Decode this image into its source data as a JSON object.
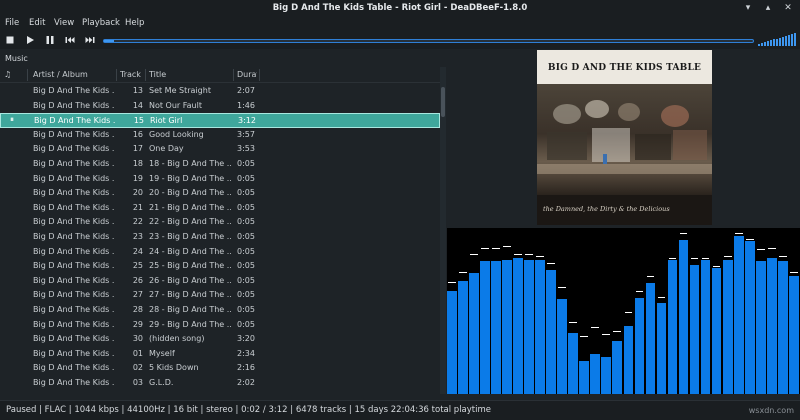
{
  "window": {
    "title": "Big D And The Kids Table - Riot Girl - DeaDBeeF-1.8.0"
  },
  "menu": [
    "File",
    "Edit",
    "View",
    "Playback",
    "Help"
  ],
  "tabs": [
    "Music"
  ],
  "columns": {
    "playing": "♫",
    "artist": "Artist / Album",
    "track": "Track No",
    "title": "Title",
    "duration": "Duration"
  },
  "rows": [
    {
      "artist": "Big D And The Kids ...",
      "track": "13",
      "title": "Set Me Straight",
      "duration": "2:07"
    },
    {
      "artist": "Big D And The Kids ...",
      "track": "14",
      "title": "Not Our Fault",
      "duration": "1:46"
    },
    {
      "artist": "Big D And The Kids ...",
      "track": "15",
      "title": "Riot Girl",
      "duration": "3:12",
      "selected": true
    },
    {
      "artist": "Big D And The Kids ...",
      "track": "16",
      "title": "Good Looking",
      "duration": "3:57"
    },
    {
      "artist": "Big D And The Kids ...",
      "track": "17",
      "title": "One Day",
      "duration": "3:53"
    },
    {
      "artist": "Big D And The Kids ...",
      "track": "18",
      "title": "18 - Big D And The ...",
      "duration": "0:05"
    },
    {
      "artist": "Big D And The Kids ...",
      "track": "19",
      "title": "19 - Big D And The ...",
      "duration": "0:05"
    },
    {
      "artist": "Big D And The Kids ...",
      "track": "20",
      "title": "20 - Big D And The ...",
      "duration": "0:05"
    },
    {
      "artist": "Big D And The Kids ...",
      "track": "21",
      "title": "21 - Big D And The ...",
      "duration": "0:05"
    },
    {
      "artist": "Big D And The Kids ...",
      "track": "22",
      "title": "22 - Big D And The ...",
      "duration": "0:05"
    },
    {
      "artist": "Big D And The Kids ...",
      "track": "23",
      "title": "23 - Big D And The ...",
      "duration": "0:05"
    },
    {
      "artist": "Big D And The Kids ...",
      "track": "24",
      "title": "24 - Big D And The ...",
      "duration": "0:05"
    },
    {
      "artist": "Big D And The Kids ...",
      "track": "25",
      "title": "25 - Big D And The ...",
      "duration": "0:05"
    },
    {
      "artist": "Big D And The Kids ...",
      "track": "26",
      "title": "26 - Big D And The ...",
      "duration": "0:05"
    },
    {
      "artist": "Big D And The Kids ...",
      "track": "27",
      "title": "27 - Big D And The ...",
      "duration": "0:05"
    },
    {
      "artist": "Big D And The Kids ...",
      "track": "28",
      "title": "28 - Big D And The ...",
      "duration": "0:05"
    },
    {
      "artist": "Big D And The Kids ...",
      "track": "29",
      "title": "29 - Big D And The ...",
      "duration": "0:05"
    },
    {
      "artist": "Big D And The Kids ...",
      "track": "30",
      "title": "(hidden song)",
      "duration": "3:20"
    },
    {
      "artist": "Big D And The Kids ...",
      "track": "01",
      "title": "Myself",
      "duration": "2:34"
    },
    {
      "artist": "Big D And The Kids ...",
      "track": "02",
      "title": "5 Kids Down",
      "duration": "2:16"
    },
    {
      "artist": "Big D And The Kids ...",
      "track": "03",
      "title": "G.L.D.",
      "duration": "2:02"
    }
  ],
  "playback": {
    "progress": 0.0161
  },
  "volume": {
    "level": 1.0
  },
  "album_art": {
    "band_text": "BIG D AND THE KIDS TABLE",
    "album_text": "the Damned, the Dirty & the Delicious"
  },
  "visualizer": {
    "bars": [
      0.62,
      0.68,
      0.73,
      0.8,
      0.8,
      0.81,
      0.82,
      0.81,
      0.81,
      0.75,
      0.57,
      0.37,
      0.2,
      0.24,
      0.22,
      0.32,
      0.41,
      0.58,
      0.67,
      0.55,
      0.81,
      0.93,
      0.78,
      0.81,
      0.76,
      0.81,
      0.95,
      0.92,
      0.8,
      0.82,
      0.8,
      0.71
    ],
    "peaks": [
      0.66,
      0.72,
      0.83,
      0.87,
      0.87,
      0.88,
      0.83,
      0.83,
      0.82,
      0.78,
      0.63,
      0.42,
      0.34,
      0.39,
      0.35,
      0.37,
      0.48,
      0.61,
      0.7,
      0.57,
      0.81,
      0.96,
      0.81,
      0.81,
      0.76,
      0.82,
      0.96,
      0.92,
      0.86,
      0.87,
      0.82,
      0.72
    ]
  },
  "status": {
    "text": "Paused | FLAC | 1044 kbps | 44100Hz | 16 bit | stereo | 0:02 / 3:12 | 6478 tracks | 15 days 22:04:36 total playtime"
  },
  "watermark": "wsxdn.com",
  "colors": {
    "accent": "#3e97f0",
    "selection": "#3fa79c",
    "visualizer_bar": "#0b7be8"
  }
}
